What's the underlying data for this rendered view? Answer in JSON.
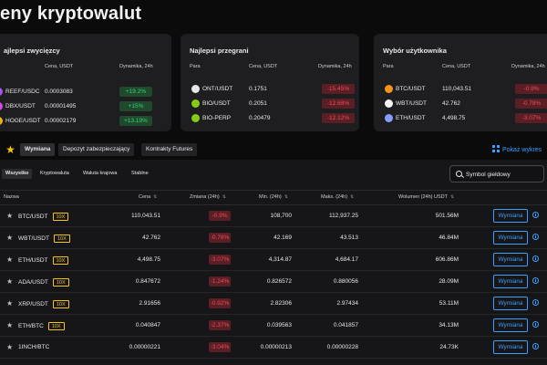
{
  "page_title": "eny kryptowalut",
  "cards": [
    {
      "title": "ajlepsi zwycięzcy",
      "col_pair": "",
      "col_price": "Cena, USDT",
      "col_change": "Dynamika, 24h",
      "rows": [
        {
          "name": "REEF/USDC",
          "price": "0.0003083",
          "change": "+19.2%",
          "dir": "up",
          "icon": "reef-coin-icon",
          "color": "#a855f7"
        },
        {
          "name": "DBX/USDT",
          "price": "0.00001495",
          "change": "+15%",
          "dir": "up",
          "icon": "dbx-coin-icon",
          "color": "#d946ef"
        },
        {
          "name": "HOGE/USDT",
          "price": "0.00002179",
          "change": "+13.19%",
          "dir": "up",
          "icon": "hoge-coin-icon",
          "color": "#eab308"
        }
      ]
    },
    {
      "title": "Najlepsi przegrani",
      "col_pair": "Para",
      "col_price": "Cena, USDT",
      "col_change": "Dynamika, 24h",
      "rows": [
        {
          "name": "ONT/USDT",
          "price": "0.1751",
          "change": "-15.45%",
          "dir": "down",
          "icon": "ont-coin-icon",
          "color": "#e5e7eb"
        },
        {
          "name": "BIO/USDT",
          "price": "0.2051",
          "change": "-12.68%",
          "dir": "down",
          "icon": "bio-coin-icon",
          "color": "#84cc16"
        },
        {
          "name": "BIO-PERP",
          "price": "0.20479",
          "change": "-12.12%",
          "dir": "down",
          "icon": "bio-perp-coin-icon",
          "color": "#84cc16"
        }
      ]
    },
    {
      "title": "Wybór użytkownika",
      "col_pair": "Para",
      "col_price": "Cena, USDT",
      "col_change": "Dynamika, 24h",
      "rows": [
        {
          "name": "BTC/USDT",
          "price": "110,043.51",
          "change": "-0.9%",
          "dir": "down",
          "icon": "btc-coin-icon",
          "color": "#f7931a"
        },
        {
          "name": "WBT/USDT",
          "price": "42.762",
          "change": "-0.78%",
          "dir": "down",
          "icon": "wbt-coin-icon",
          "color": "#f5f5f5"
        },
        {
          "name": "ETH/USDT",
          "price": "4,498.75",
          "change": "-3.07%",
          "dir": "down",
          "icon": "eth-coin-icon",
          "color": "#8b9cff"
        }
      ]
    }
  ],
  "tabs": [
    "Wymiana",
    "Depozyt zabezpieczający",
    "Kontrakty Futures"
  ],
  "active_tab": "Wymiana",
  "show_link": "Pokaż wykres",
  "filters": [
    "Wszystko",
    "Kryptowaluta",
    "Waluta krajowa",
    "Stablne"
  ],
  "active_filter": "Wszystko",
  "search": {
    "placeholder": "Symbol giełdowy"
  },
  "table": {
    "headers": [
      "Nazwa",
      "Cena",
      "Zmiana (24h)",
      "Min. (24h)",
      "Maks. (24h)",
      "Wolumen (24h) USDT"
    ],
    "trade_label": "Wymiana",
    "rows": [
      {
        "pair": "BTC/USDT",
        "lev": "10X",
        "price": "110,043.51",
        "change": "-0.9%",
        "low": "108,700",
        "high": "112,937.25",
        "volume": "501.56M"
      },
      {
        "pair": "WBT/USDT",
        "lev": "10X",
        "price": "42.762",
        "change": "-0.78%",
        "low": "42.169",
        "high": "43.513",
        "volume": "46.84M"
      },
      {
        "pair": "ETH/USDT",
        "lev": "10X",
        "price": "4,498.75",
        "change": "-3.07%",
        "low": "4,314.87",
        "high": "4,684.17",
        "volume": "606.86M"
      },
      {
        "pair": "ADA/USDT",
        "lev": "10X",
        "price": "0.847672",
        "change": "-1.24%",
        "low": "0.826572",
        "high": "0.880056",
        "volume": "28.09M"
      },
      {
        "pair": "XRP/USDT",
        "lev": "10X",
        "price": "2.91656",
        "change": "-0.92%",
        "low": "2.82306",
        "high": "2.97434",
        "volume": "53.11M"
      },
      {
        "pair": "ETH/BTC",
        "lev": "10X",
        "price": "0.040847",
        "change": "-2.37%",
        "low": "0.039563",
        "high": "0.041857",
        "volume": "34.13M"
      },
      {
        "pair": "1INCH/BTC",
        "lev": "",
        "price": "0.00000221",
        "change": "-3.04%",
        "low": "0.00000213",
        "high": "0.00000228",
        "volume": "24.73K"
      }
    ]
  },
  "colors": {
    "accent": "#3aa0ff",
    "up": "#38d36f",
    "down": "#ef4b57",
    "leverage": "#f5c518"
  }
}
